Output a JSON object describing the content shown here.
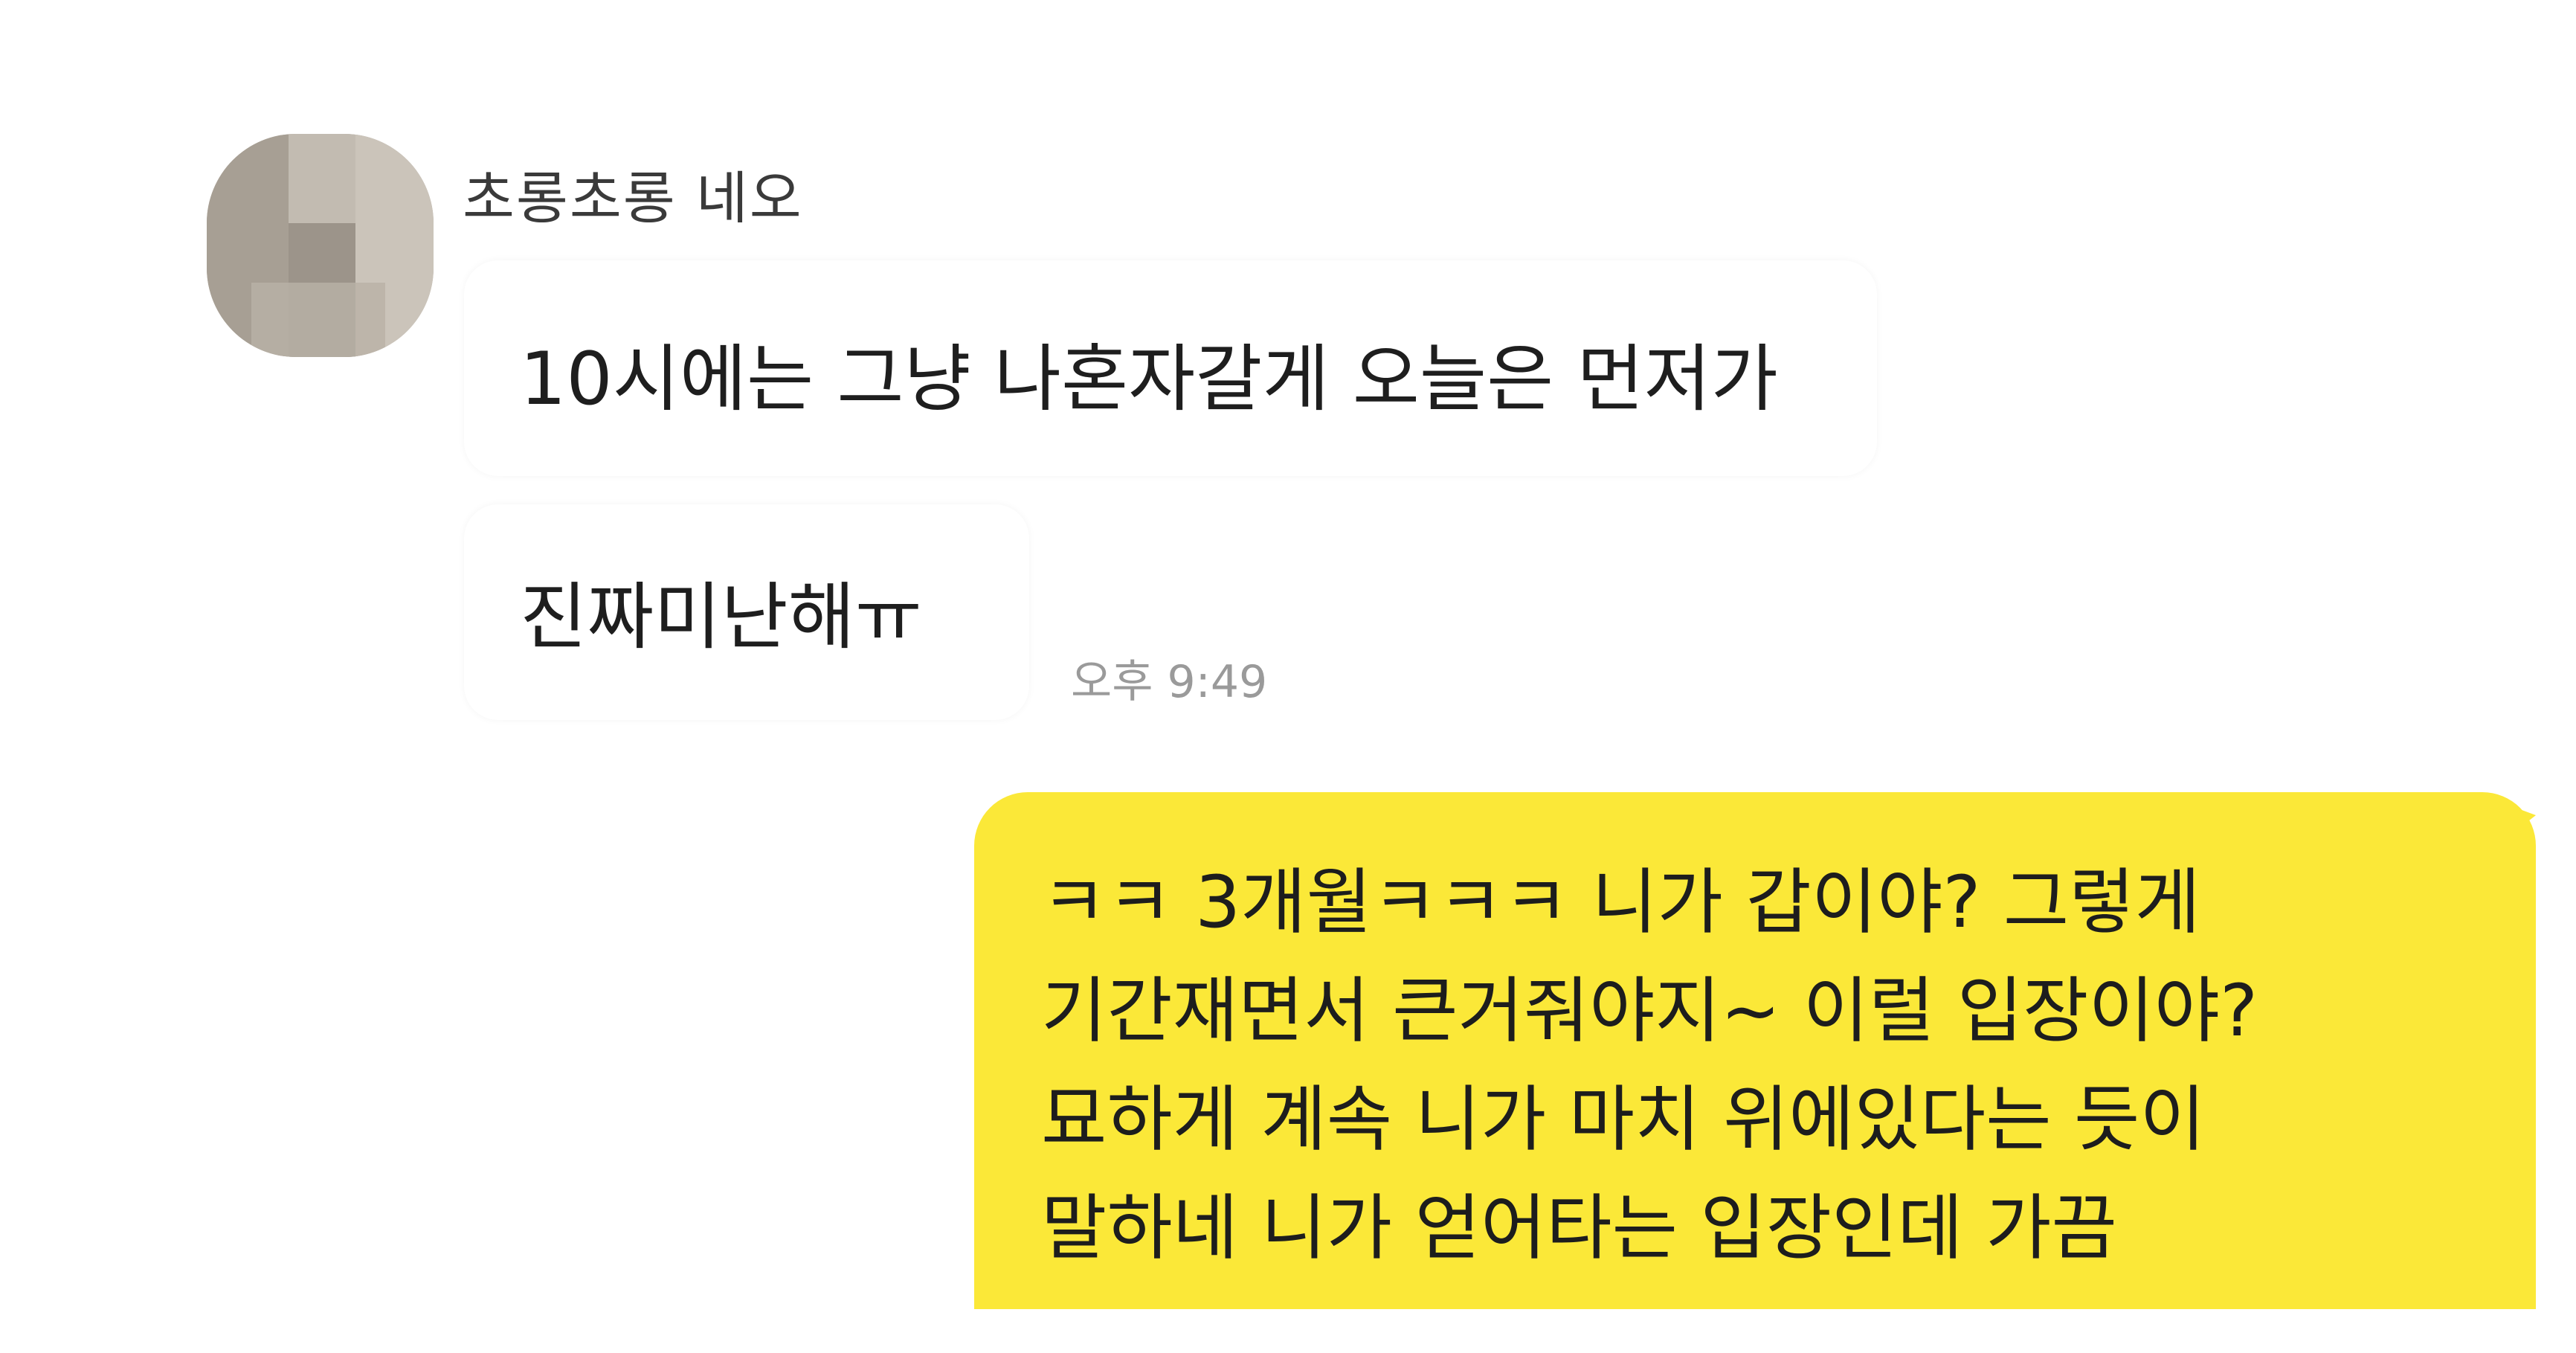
{
  "chat": {
    "incoming": {
      "sender_name": "초롱초롱 네오",
      "avatar_icon": "blurred-profile-photo",
      "messages": [
        "10시에는 그냥 나혼자갈게 오늘은 먼저가",
        "진짜미난해ㅠ"
      ],
      "timestamp": "오후 9:49"
    },
    "outgoing": {
      "lines": [
        "ㅋㅋ 3개월ㅋㅋㅋ 니가 갑이야? 그렇게",
        "기간재면서 큰거줘야지~ 이럴 입장이야?",
        "묘하게 계속 니가 마치 위에있다는 듯이",
        "말하네 니가 얻어타는 입장인데 가끔"
      ]
    },
    "colors": {
      "background": "#ffffff",
      "incoming_bubble": "#ffffff",
      "outgoing_bubble": "#fbe838",
      "timestamp": "#9a9a9a"
    }
  }
}
